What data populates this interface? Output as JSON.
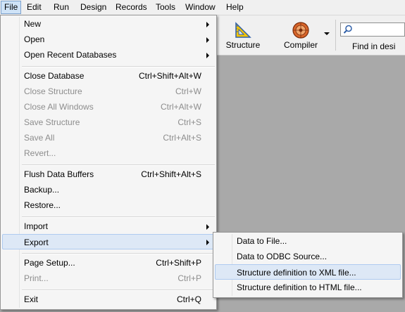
{
  "menubar": {
    "items": [
      "File",
      "Edit",
      "Run",
      "Design",
      "Records",
      "Tools",
      "Window",
      "Help"
    ]
  },
  "toolbar": {
    "structure_label": "Structure",
    "compiler_label": "Compiler",
    "find_label": "Find in desi"
  },
  "file_menu": {
    "new": "New",
    "open": "Open",
    "open_recent": "Open Recent Databases",
    "close_database": "Close Database",
    "close_database_sc": "Ctrl+Shift+Alt+W",
    "close_structure": "Close Structure",
    "close_structure_sc": "Ctrl+W",
    "close_all_windows": "Close All Windows",
    "close_all_windows_sc": "Ctrl+Alt+W",
    "save_structure": "Save Structure",
    "save_structure_sc": "Ctrl+S",
    "save_all": "Save All",
    "save_all_sc": "Ctrl+Alt+S",
    "revert": "Revert...",
    "flush": "Flush Data Buffers",
    "flush_sc": "Ctrl+Shift+Alt+S",
    "backup": "Backup...",
    "restore": "Restore...",
    "import": "Import",
    "export": "Export",
    "page_setup": "Page Setup...",
    "page_setup_sc": "Ctrl+Shift+P",
    "print": "Print...",
    "print_sc": "Ctrl+P",
    "exit": "Exit",
    "exit_sc": "Ctrl+Q"
  },
  "export_menu": {
    "data_to_file": "Data to File...",
    "data_to_odbc": "Data to ODBC Source...",
    "structure_xml": "Structure definition to XML file...",
    "structure_html": "Structure definition to HTML file..."
  }
}
